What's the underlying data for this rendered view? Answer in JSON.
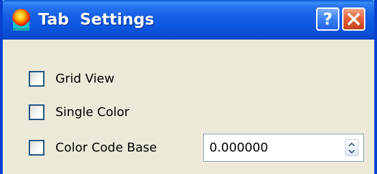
{
  "window": {
    "title": "Tab  Settings",
    "help_label": "?",
    "icons": {
      "app": "app-globe-icon",
      "help": "help-icon",
      "close": "close-icon"
    },
    "colors": {
      "titlebar": "#0a5ad8",
      "client_bg": "#ece9d8",
      "close_button": "#e5643d"
    }
  },
  "options": {
    "grid_view": {
      "label": "Grid View",
      "checked": false
    },
    "single_color": {
      "label": "Single Color",
      "checked": false
    },
    "color_code_base": {
      "label": "Color Code Base",
      "checked": false,
      "value": "0.000000"
    }
  }
}
